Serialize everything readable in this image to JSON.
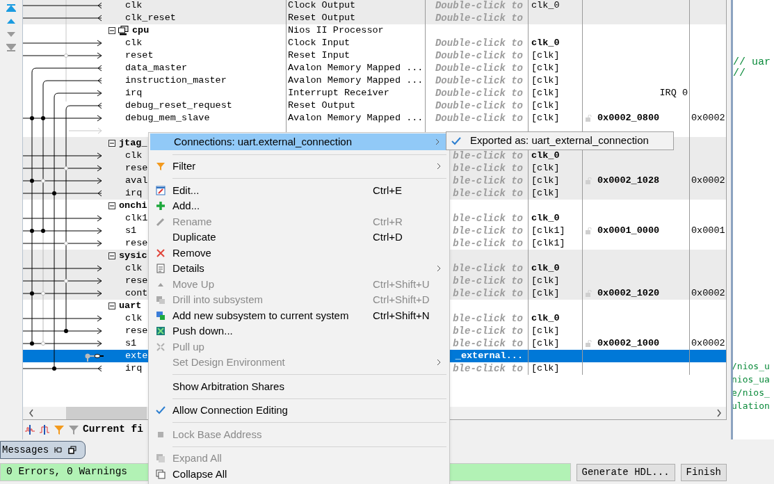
{
  "table": {
    "rows": [
      {
        "kind": "port",
        "name": "clk",
        "description": "Clock Output",
        "export": "Double-click to",
        "exported": false,
        "clock": "clk_0",
        "clock_bold": false,
        "shaded": true,
        "selected": false
      },
      {
        "kind": "port",
        "name": "clk_reset",
        "description": "Reset Output",
        "export": "Double-click to",
        "exported": false,
        "shaded": true,
        "selected": false
      },
      {
        "kind": "processor",
        "name": "cpu",
        "expanded": true,
        "description": "Nios II Processor",
        "shaded": false,
        "selected": false
      },
      {
        "kind": "port",
        "name": "clk",
        "description": "Clock Input",
        "export": "Double-click to",
        "exported": false,
        "clock": "clk_0",
        "clock_bold": true,
        "shaded": false,
        "selected": false
      },
      {
        "kind": "port",
        "name": "reset",
        "description": "Reset Input",
        "export": "Double-click to",
        "exported": false,
        "clock": "[clk]",
        "clock_bold": false,
        "shaded": false,
        "selected": false
      },
      {
        "kind": "port",
        "name": "data_master",
        "description": "Avalon Memory Mapped ...",
        "export": "Double-click to",
        "exported": false,
        "clock": "[clk]",
        "clock_bold": false,
        "shaded": false,
        "selected": false
      },
      {
        "kind": "port",
        "name": "instruction_master",
        "description": "Avalon Memory Mapped ...",
        "export": "Double-click to",
        "exported": false,
        "clock": "[clk]",
        "clock_bold": false,
        "shaded": false,
        "selected": false
      },
      {
        "kind": "port",
        "name": "irq",
        "description": "Interrupt Receiver",
        "export": "Double-click to",
        "exported": false,
        "clock": "[clk]",
        "clock_bold": false,
        "irq": "IRQ 0",
        "shaded": false,
        "selected": false
      },
      {
        "kind": "port",
        "name": "debug_reset_request",
        "description": "Reset Output",
        "export": "Double-click to",
        "exported": false,
        "clock": "[clk]",
        "clock_bold": false,
        "shaded": false,
        "selected": false
      },
      {
        "kind": "port",
        "name": "debug_mem_slave",
        "description": "Avalon Memory Mapped ...",
        "export": "Double-click to",
        "exported": false,
        "clock": "[clk]",
        "clock_bold": false,
        "base": "0x0002_0800",
        "end": "0x0002",
        "shaded": false,
        "selected": false
      },
      {
        "kind": "port",
        "shaded": false,
        "selected": false
      },
      {
        "kind": "component",
        "name": "jtag_",
        "expanded": true,
        "shaded": true,
        "selected": false
      },
      {
        "kind": "port",
        "name": "clk",
        "export": "ble-click to",
        "exported": false,
        "clock": "clk_0",
        "clock_bold": true,
        "shaded": true,
        "selected": false
      },
      {
        "kind": "port",
        "name": "rese",
        "export": "ble-click to",
        "exported": false,
        "clock": "[clk]",
        "clock_bold": false,
        "shaded": true,
        "selected": false
      },
      {
        "kind": "port",
        "name": "aval",
        "export": "ble-click to",
        "exported": false,
        "clock": "[clk]",
        "clock_bold": false,
        "base": "0x0002_1028",
        "end": "0x0002",
        "shaded": true,
        "selected": false
      },
      {
        "kind": "port",
        "name": "irq",
        "export": "ble-click to",
        "exported": false,
        "clock": "[clk]",
        "clock_bold": false,
        "shaded": true,
        "selected": false
      },
      {
        "kind": "component",
        "name": "onchi",
        "expanded": true,
        "shaded": false,
        "selected": false
      },
      {
        "kind": "port",
        "name": "clk1",
        "export": "ble-click to",
        "exported": false,
        "clock": "clk_0",
        "clock_bold": true,
        "shaded": false,
        "selected": false
      },
      {
        "kind": "port",
        "name": "s1",
        "export": "ble-click to",
        "exported": false,
        "clock": "[clk1]",
        "clock_bold": false,
        "base": "0x0001_0000",
        "end": "0x0001",
        "shaded": false,
        "selected": false
      },
      {
        "kind": "port",
        "name": "rese",
        "export": "ble-click to",
        "exported": false,
        "clock": "[clk1]",
        "clock_bold": false,
        "shaded": false,
        "selected": false
      },
      {
        "kind": "component",
        "name": "sysic",
        "expanded": true,
        "shaded": true,
        "selected": false
      },
      {
        "kind": "port",
        "name": "clk",
        "export": "ble-click to",
        "exported": false,
        "clock": "clk_0",
        "clock_bold": true,
        "shaded": true,
        "selected": false
      },
      {
        "kind": "port",
        "name": "rese",
        "export": "ble-click to",
        "exported": false,
        "clock": "[clk]",
        "clock_bold": false,
        "shaded": true,
        "selected": false
      },
      {
        "kind": "port",
        "name": "cont",
        "export": "ble-click to",
        "exported": false,
        "clock": "[clk]",
        "clock_bold": false,
        "base": "0x0002_1020",
        "end": "0x0002",
        "shaded": true,
        "selected": false
      },
      {
        "kind": "component",
        "name": "uart",
        "expanded": true,
        "shaded": false,
        "selected": false
      },
      {
        "kind": "port",
        "name": "clk",
        "export": "ble-click to",
        "exported": false,
        "clock": "clk_0",
        "clock_bold": true,
        "shaded": false,
        "selected": false
      },
      {
        "kind": "port",
        "name": "rese",
        "export": "ble-click to",
        "exported": false,
        "clock": "[clk]",
        "clock_bold": false,
        "shaded": false,
        "selected": false
      },
      {
        "kind": "port",
        "name": "s1",
        "export": "ble-click to",
        "exported": false,
        "clock": "[clk]",
        "clock_bold": false,
        "base": "0x0002_1000",
        "end": "0x0002",
        "shaded": false,
        "selected": false
      },
      {
        "kind": "port",
        "name": "exte",
        "export": "_external...",
        "exported": true,
        "shaded": false,
        "selected": true
      },
      {
        "kind": "port",
        "name": "irq",
        "export": "ble-click to",
        "exported": false,
        "clock": "[clk]",
        "clock_bold": false,
        "shaded": false,
        "selected": false
      }
    ]
  },
  "table_toolbar": {
    "filter_label": "Current fi"
  },
  "messages_tab": {
    "label": "Messages"
  },
  "status_bar": {
    "text": "0 Errors, 0 Warnings"
  },
  "buttons": [
    "Generate HDL...",
    "Finish"
  ],
  "editor": {
    "lines_top": [
      "//  uar",
      "//"
    ],
    "lines_bottom": [
      "/nios_u",
      "nios_ua",
      "e/nios_",
      "ulation"
    ]
  },
  "context_menu": {
    "items": [
      {
        "kind": "item",
        "label": "Connections: uart.external_connection",
        "submenu": true,
        "selected": true,
        "disabled": false,
        "checked": false
      },
      {
        "kind": "separator"
      },
      {
        "kind": "item",
        "label": "Filter",
        "submenu": true,
        "selected": false,
        "disabled": false,
        "checked": false
      },
      {
        "kind": "separator"
      },
      {
        "kind": "item",
        "label": "Edit...",
        "shortcut": "Ctrl+E",
        "submenu": false,
        "selected": false,
        "disabled": false,
        "checked": false
      },
      {
        "kind": "item",
        "label": "Add...",
        "submenu": false,
        "selected": false,
        "disabled": false,
        "checked": false
      },
      {
        "kind": "item",
        "label": "Rename",
        "shortcut": "Ctrl+R",
        "submenu": false,
        "selected": false,
        "disabled": true,
        "checked": false
      },
      {
        "kind": "item",
        "label": "Duplicate",
        "shortcut": "Ctrl+D",
        "submenu": false,
        "selected": false,
        "disabled": false,
        "checked": false
      },
      {
        "kind": "item",
        "label": "Remove",
        "submenu": false,
        "selected": false,
        "disabled": false,
        "checked": false
      },
      {
        "kind": "item",
        "label": "Details",
        "submenu": true,
        "selected": false,
        "disabled": false,
        "checked": false
      },
      {
        "kind": "item",
        "label": "Move Up",
        "shortcut": "Ctrl+Shift+U",
        "submenu": false,
        "selected": false,
        "disabled": true,
        "checked": false
      },
      {
        "kind": "item",
        "label": "Drill into subsystem",
        "shortcut": "Ctrl+Shift+D",
        "submenu": false,
        "selected": false,
        "disabled": true,
        "checked": false
      },
      {
        "kind": "item",
        "label": "Add new subsystem to current system",
        "shortcut": "Ctrl+Shift+N",
        "submenu": false,
        "selected": false,
        "disabled": false,
        "checked": false
      },
      {
        "kind": "item",
        "label": "Push down...",
        "submenu": false,
        "selected": false,
        "disabled": false,
        "checked": false
      },
      {
        "kind": "item",
        "label": "Pull up",
        "submenu": false,
        "selected": false,
        "disabled": true,
        "checked": false
      },
      {
        "kind": "item",
        "label": "Set Design Environment",
        "submenu": true,
        "selected": false,
        "disabled": true,
        "checked": false
      },
      {
        "kind": "separator"
      },
      {
        "kind": "item",
        "label": "Show Arbitration Shares",
        "submenu": false,
        "selected": false,
        "disabled": false,
        "checked": false
      },
      {
        "kind": "separator"
      },
      {
        "kind": "item",
        "label": "Allow Connection Editing",
        "submenu": false,
        "selected": false,
        "disabled": false,
        "checked": true
      },
      {
        "kind": "separator"
      },
      {
        "kind": "item",
        "label": "Lock Base Address",
        "submenu": false,
        "selected": false,
        "disabled": true,
        "checked": false
      },
      {
        "kind": "separator"
      },
      {
        "kind": "item",
        "label": "Expand All",
        "submenu": false,
        "selected": false,
        "disabled": true,
        "checked": false
      },
      {
        "kind": "item",
        "label": "Collapse All",
        "submenu": false,
        "selected": false,
        "disabled": false,
        "checked": false
      }
    ]
  },
  "submenu": {
    "items": [
      {
        "label": "Exported as: uart_external_connection",
        "checked": true
      }
    ]
  }
}
